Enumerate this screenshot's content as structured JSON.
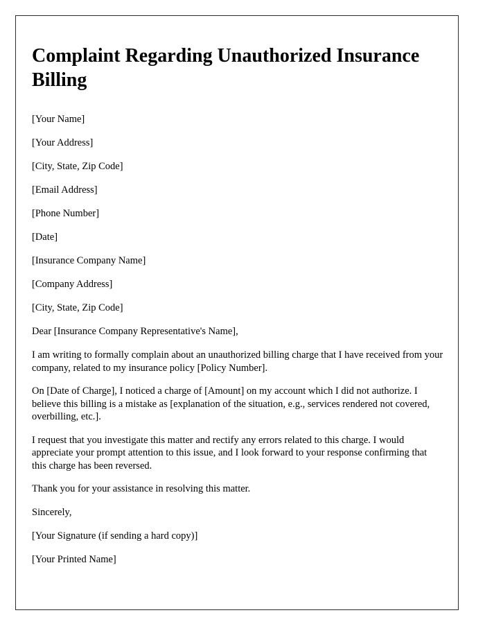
{
  "document": {
    "title": "Complaint Regarding Unauthorized Insurance Billing",
    "sender_block": [
      "[Your Name]",
      "[Your Address]",
      "[City, State, Zip Code]",
      "[Email Address]",
      "[Phone Number]",
      "[Date]"
    ],
    "recipient_block": [
      "[Insurance Company Name]",
      "[Company Address]",
      "[City, State, Zip Code]"
    ],
    "salutation": "Dear [Insurance Company Representative's Name],",
    "paragraphs": [
      "I am writing to formally complain about an unauthorized billing charge that I have received from your company, related to my insurance policy [Policy Number].",
      "On [Date of Charge], I noticed a charge of [Amount] on my account which I did not authorize. I believe this billing is a mistake as [explanation of the situation, e.g., services rendered not covered, overbilling, etc.].",
      "I request that you investigate this matter and rectify any errors related to this charge. I would appreciate your prompt attention to this issue, and I look forward to your response confirming that this charge has been reversed.",
      "Thank you for your assistance in resolving this matter."
    ],
    "closing": "Sincerely,",
    "signature_line": "[Your Signature (if sending a hard copy)]",
    "printed_name_line": "[Your Printed Name]"
  }
}
